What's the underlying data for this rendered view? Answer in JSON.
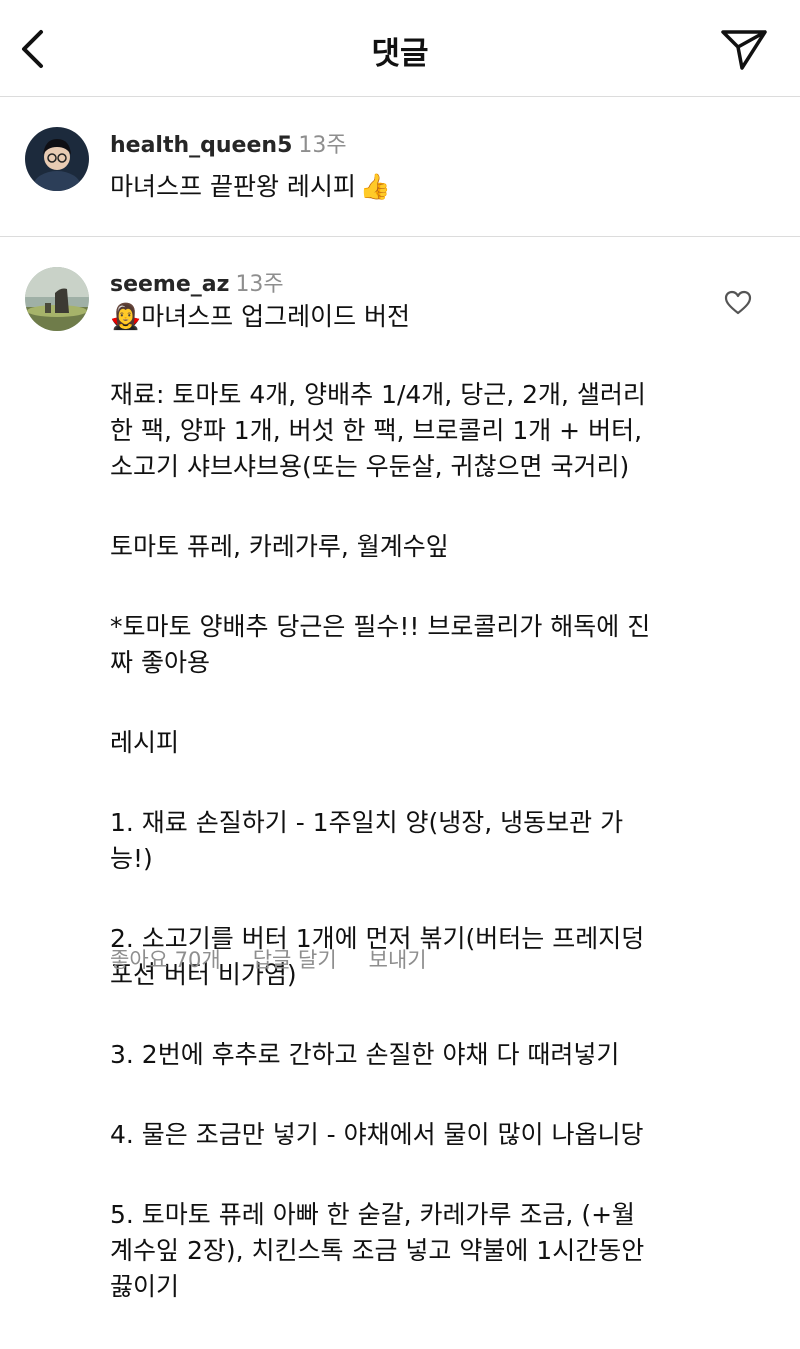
{
  "header": {
    "title": "댓글",
    "back_icon": "chevron-left-icon",
    "send_icon": "paper-plane-icon"
  },
  "caption": {
    "username": "health_queen5",
    "time": "13주",
    "text": "마녀스프 끝판왕 레시피",
    "emoji": "👍"
  },
  "comment": {
    "username": "seeme_az",
    "time": "13주",
    "title_emoji": "🧛‍♀️",
    "lines": [
      "마녀스프 업그레이드 버전",
      "재료: 토마토 4개, 양배추 1/4개, 당근, 2개, 샐러리\n한 팩, 양파 1개, 버섯 한 팩, 브로콜리 1개 + 버터,\n소고기 샤브샤브용(또는 우둔살, 귀찮으면 국거리)",
      "토마토 퓨레, 카레가루, 월계수잎",
      "*토마토 양배추 당근은 필수!! 브로콜리가 해독에 진\n짜 좋아용",
      "레시피",
      "1. 재료 손질하기 - 1주일치 양(냉장, 냉동보관 가\n능!)",
      "2. 소고기를 버터 1개에 먼저 볶기(버터는 프레지덩\n포션 버터 비가염)",
      "3. 2번에 후추로 간하고 손질한 야채 다 때려넣기",
      "4. 물은 조금만 넣기 - 야채에서 물이 많이 나옵니당",
      "5. 토마토 퓨레 아빠 한 숟갈, 카레가루 조금, (+월\n계수잎 2장), 치킨스톡 조금 넣고 약불에 1시간동안\n끓이기"
    ],
    "likes_label": "좋아요 70개",
    "reply_label": "답글 달기",
    "send_label": "보내기",
    "heart_icon": "heart-outline-icon"
  }
}
